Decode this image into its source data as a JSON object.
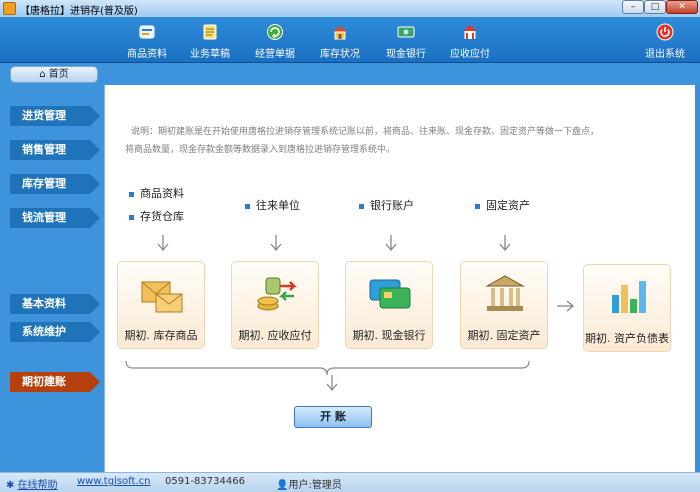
{
  "window": {
    "title": "【唐格拉】进销存(普及版)",
    "min_label": "–",
    "max_label": "□",
    "close_label": "✕"
  },
  "toolbar": [
    {
      "label": "商品资料",
      "icon": "product-icon"
    },
    {
      "label": "业务草稿",
      "icon": "draft-icon"
    },
    {
      "label": "经营单据",
      "icon": "documents-icon"
    },
    {
      "label": "库存状况",
      "icon": "inventory-icon"
    },
    {
      "label": "现金银行",
      "icon": "cash-bank-icon"
    },
    {
      "label": "应收应付",
      "icon": "receivable-icon"
    },
    {
      "label": "退出系统",
      "icon": "power-icon"
    }
  ],
  "breadcrumb": {
    "home": "首页"
  },
  "nav": [
    {
      "label": "进货管理"
    },
    {
      "label": "销售管理"
    },
    {
      "label": "库存管理"
    },
    {
      "label": "钱流管理"
    },
    {
      "label": "基本资料"
    },
    {
      "label": "系统维护"
    },
    {
      "label": "期初建账",
      "active": true
    }
  ],
  "description": {
    "line1": "说明：期初建账是在开始使用唐格拉进销存管理系统记账以前，将商品、往来账、现金存款、固定资产等做一下盘点，",
    "line2": "将商品数量，现金存款金额等数据录入到唐格拉进销存管理系统中。"
  },
  "bullets": {
    "goods": "商品资料",
    "warehouse": "存货仓库",
    "partners": "往来单位",
    "bank": "银行账户",
    "assets": "固定资产"
  },
  "cards": [
    {
      "label": "期初. 库存商品",
      "icon": "envelope-boxes-icon"
    },
    {
      "label": "期初. 应收应付",
      "icon": "money-arrows-icon"
    },
    {
      "label": "期初. 现金银行",
      "icon": "bank-card-icon"
    },
    {
      "label": "期初. 固定资产",
      "icon": "bank-building-icon"
    },
    {
      "label": "期初. 资产负债表",
      "icon": "bar-chart-icon"
    }
  ],
  "start_button": "开 账",
  "status": {
    "help": "在线帮助",
    "website": "www.tglsoft.cn",
    "phone": "0591-83734466",
    "user": "用户:管理员"
  },
  "colors": {
    "accent": "#1f73b9",
    "active_nav": "#b5410e"
  }
}
